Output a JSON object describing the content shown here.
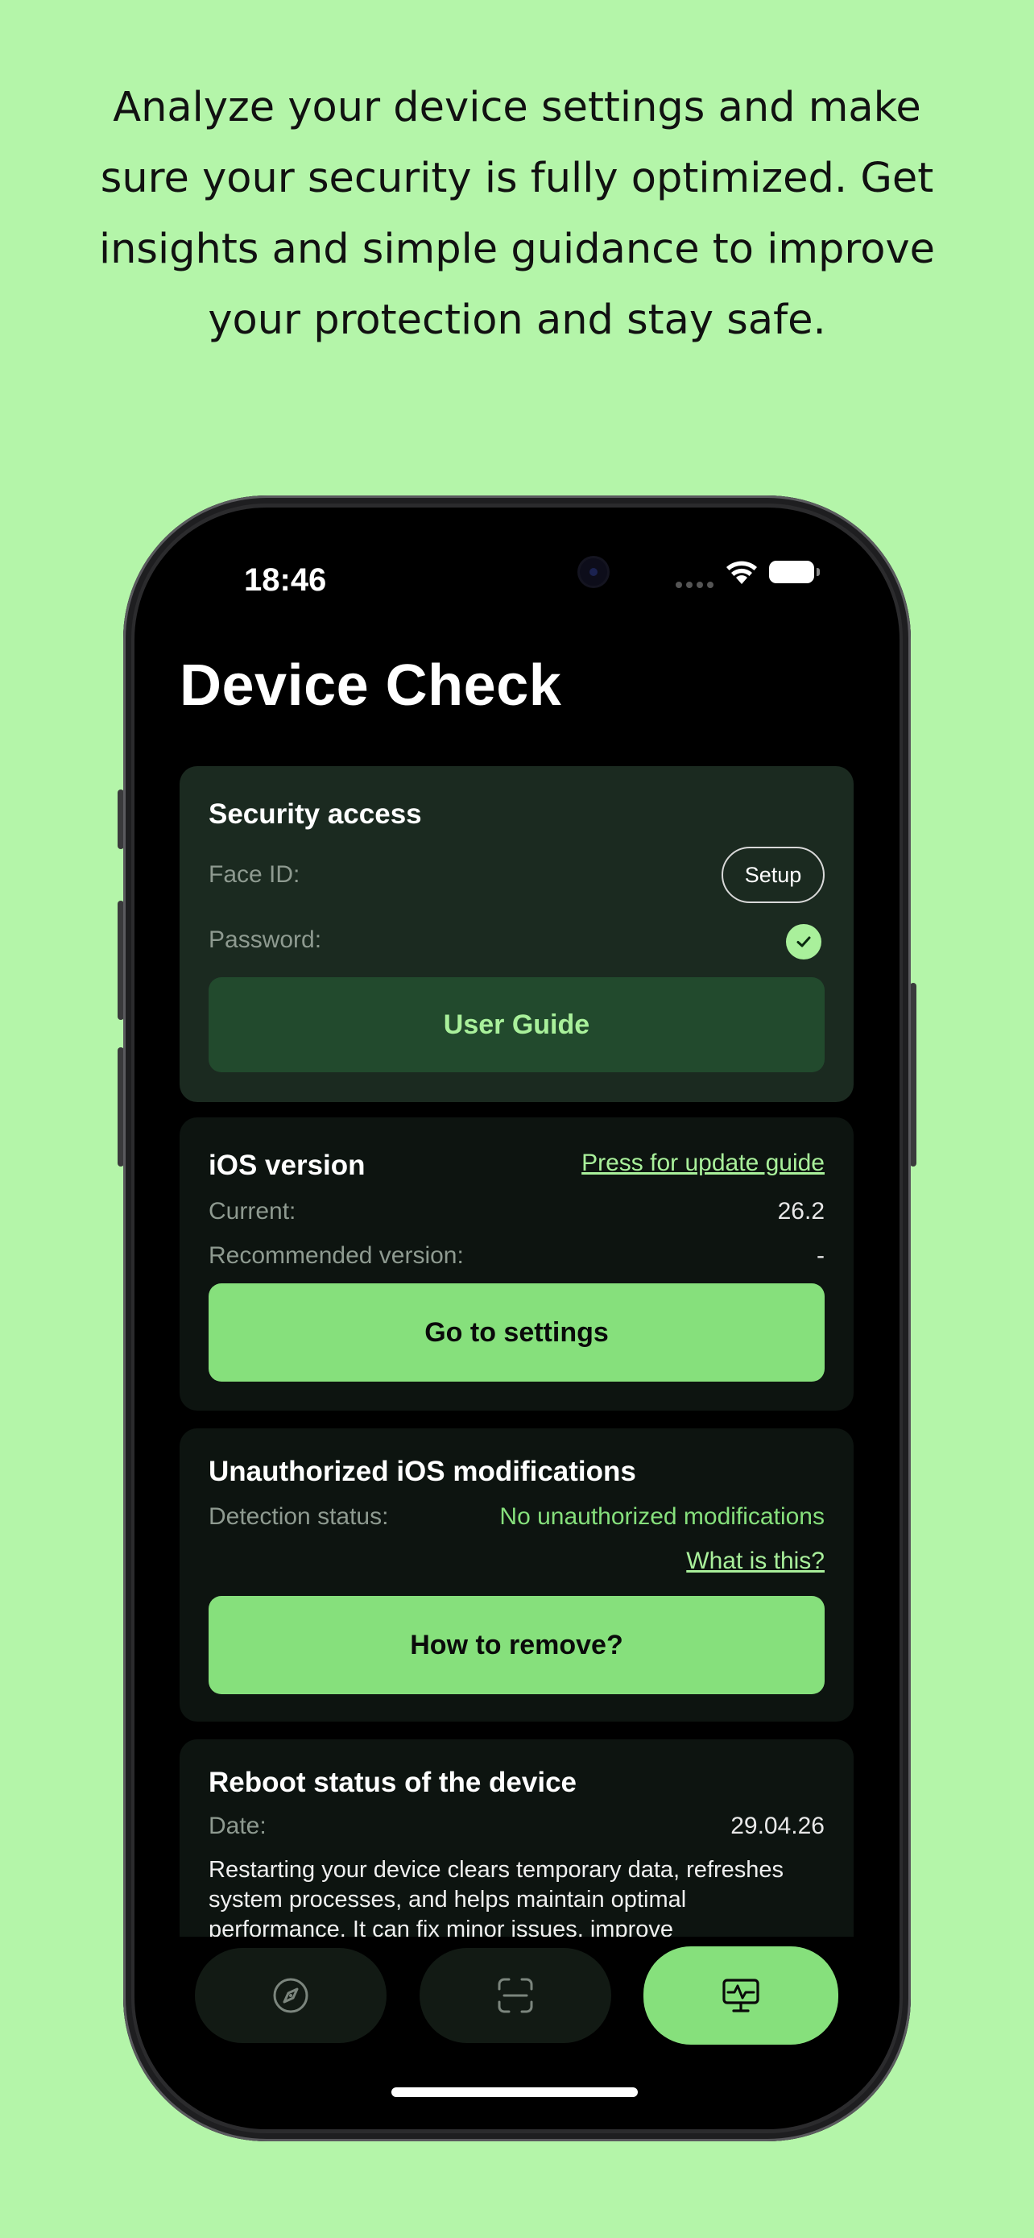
{
  "tagline": "Analyze your device settings and make sure your security is fully optimized. Get insights and simple guidance to improve your protection and stay safe.",
  "status_bar": {
    "time": "18:46"
  },
  "app": {
    "title": "Device Check"
  },
  "security": {
    "title": "Security access",
    "face_id_label": "Face ID:",
    "setup_label": "Setup",
    "password_label": "Password:",
    "user_guide_label": "User Guide"
  },
  "ios": {
    "title": "iOS version",
    "update_link": "Press for update guide",
    "current_label": "Current:",
    "current_value": "26.2",
    "recommended_label": "Recommended version:",
    "recommended_value": "-",
    "settings_button": "Go to settings"
  },
  "mods": {
    "title": "Unauthorized iOS modifications",
    "status_label": "Detection status:",
    "status_value": "No unauthorized modifications",
    "what_link": "What is this?",
    "remove_button": "How to remove?"
  },
  "reboot": {
    "title": "Reboot status of the device",
    "date_label": "Date:",
    "date_value": "29.04.26",
    "description": "Restarting your device clears temporary data, refreshes system processes, and helps maintain optimal performance. It can fix minor issues, improve"
  },
  "tabs": [
    {
      "icon": "compass-icon",
      "active": false
    },
    {
      "icon": "scan-icon",
      "active": false
    },
    {
      "icon": "monitor-pulse-icon",
      "active": true
    }
  ],
  "colors": {
    "background": "#b4f5a9",
    "accent": "#86e07c",
    "accent_text": "#a9f09b",
    "card": "#0d1410",
    "card_highlight": "#1b2a20"
  }
}
